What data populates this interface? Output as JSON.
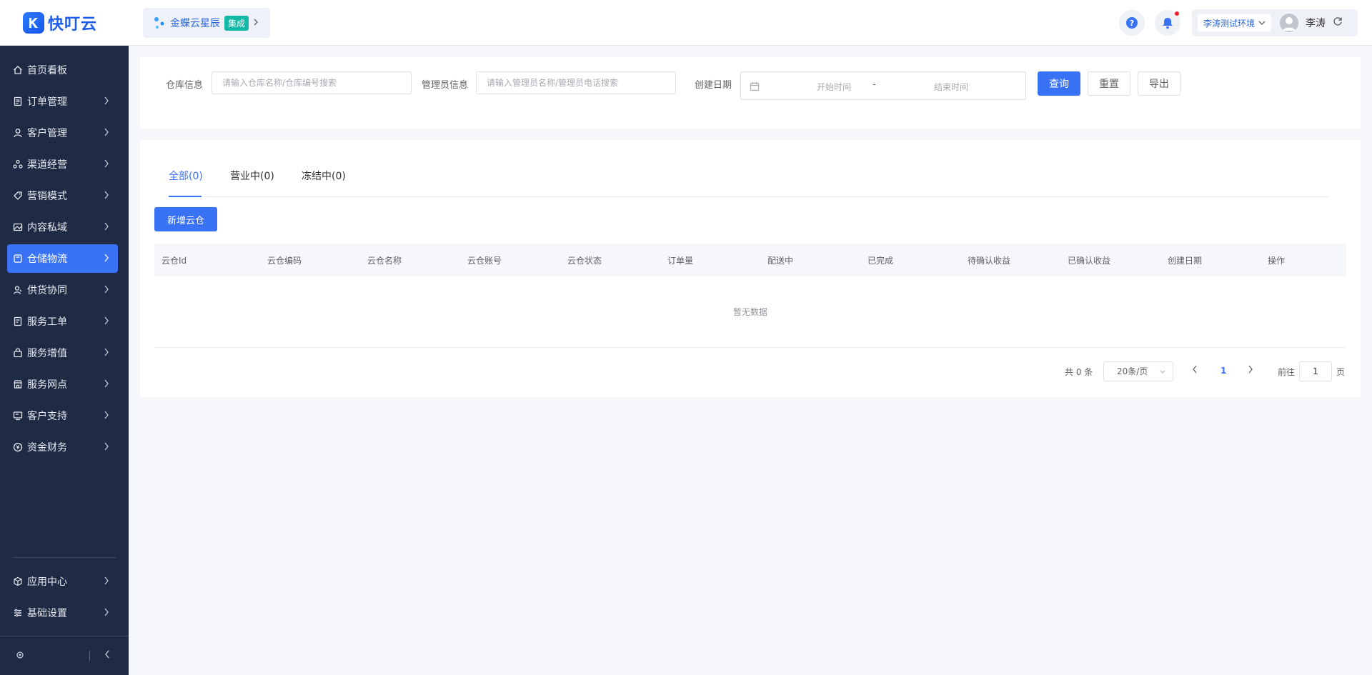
{
  "brand": {
    "name": "快叮云"
  },
  "product": {
    "name": "金蝶云星辰",
    "badge": "集成"
  },
  "header": {
    "environment": "李涛测试环境",
    "username": "李涛"
  },
  "sidebar": {
    "items": [
      {
        "label": "首页看板",
        "icon": "home-icon",
        "has_submenu": false
      },
      {
        "label": "订单管理",
        "icon": "order-icon",
        "has_submenu": true
      },
      {
        "label": "客户管理",
        "icon": "user-icon",
        "has_submenu": true
      },
      {
        "label": "渠道经营",
        "icon": "channel-icon",
        "has_submenu": true
      },
      {
        "label": "营销模式",
        "icon": "tag-icon",
        "has_submenu": true
      },
      {
        "label": "内容私域",
        "icon": "image-icon",
        "has_submenu": true
      },
      {
        "label": "仓储物流",
        "icon": "warehouse-icon",
        "has_submenu": true,
        "active": true
      },
      {
        "label": "供货协同",
        "icon": "supply-user-icon",
        "has_submenu": true
      },
      {
        "label": "服务工单",
        "icon": "ticket-icon",
        "has_submenu": true
      },
      {
        "label": "服务增值",
        "icon": "bag-icon",
        "has_submenu": true
      },
      {
        "label": "服务网点",
        "icon": "store-icon",
        "has_submenu": true
      },
      {
        "label": "客户支持",
        "icon": "support-icon",
        "has_submenu": true
      },
      {
        "label": "资金财务",
        "icon": "yuan-icon",
        "has_submenu": true
      }
    ],
    "bottom_items": [
      {
        "label": "应用中心",
        "icon": "cube-icon"
      },
      {
        "label": "基础设置",
        "icon": "settings-sliders-icon"
      }
    ]
  },
  "filters": {
    "warehouse_label": "仓库信息",
    "warehouse_placeholder": "请输入仓库名称/仓库编号搜索",
    "admin_label": "管理员信息",
    "admin_placeholder": "请输入管理员名称/管理员电话搜索",
    "date_label": "创建日期",
    "start_placeholder": "开始时间",
    "separator": "-",
    "end_placeholder": "结束时间",
    "query_button": "查询",
    "reset_button": "重置",
    "export_button": "导出"
  },
  "tabs": [
    {
      "label": "全部(0)",
      "active": true
    },
    {
      "label": "营业中(0)",
      "active": false
    },
    {
      "label": "冻结中(0)",
      "active": false
    }
  ],
  "add_button": "新增云仓",
  "table": {
    "columns": [
      "云仓Id",
      "云仓编码",
      "云仓名称",
      "云仓账号",
      "云仓状态",
      "订单量",
      "配送中",
      "已完成",
      "待确认收益",
      "已确认收益",
      "创建日期",
      "操作"
    ],
    "rows": [],
    "empty_text": "暂无数据"
  },
  "pagination": {
    "total_text": "共 0 条",
    "page_size": "20条/页",
    "current_page": "1",
    "goto_label": "前往",
    "goto_value": "1",
    "page_suffix": "页"
  },
  "colors": {
    "primary": "#3a72f5",
    "sidebar_bg": "#1f2a44",
    "badge": "#14b8a6"
  }
}
